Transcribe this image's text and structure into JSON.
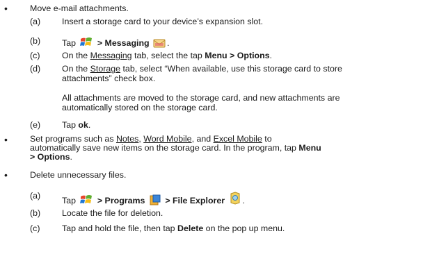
{
  "bullets": [
    {
      "text": "Move e-mail attachments."
    },
    {
      "lines": [
        "Set programs such as ",
        "Notes",
        ", ",
        "Word Mobile",
        ", and ",
        "Excel Mobile",
        " to",
        "automatically save new items on the storage card. In the program, tap ",
        "Menu",
        "> Options",
        "."
      ]
    },
    {
      "text": "Delete unnecessary files."
    }
  ],
  "steps1": {
    "a": {
      "label": "(a)",
      "text": "Insert a storage card to your device’s expansion slot."
    },
    "b": {
      "label": "(b)",
      "pre": "Tap ",
      "bold": "> Messaging",
      "post": "."
    },
    "c": {
      "label": "(c)",
      "pre": "On the ",
      "link": "Messaging",
      "mid": " tab, select the tap ",
      "bold": "Menu > Options",
      "post": "."
    },
    "d": {
      "label": "(d)",
      "pre": "On the ",
      "link": "Storage",
      "line1": " tab, select “When available, use this storage card to store",
      "line2": "attachments” check box."
    },
    "d_para": {
      "line1": "All attachments are moved to the storage card, and new attachments are",
      "line2": "automatically stored on the storage card."
    },
    "e": {
      "label": "(e)",
      "pre": "Tap ",
      "bold": "ok",
      "post": "."
    }
  },
  "steps3": {
    "a": {
      "label": "(a)",
      "pre": "Tap ",
      "bold1": "> Programs",
      "bold2": "> File Explorer",
      "post": "."
    },
    "b": {
      "label": "(b)",
      "text": "Locate the file for deletion."
    },
    "c": {
      "label": "(c)",
      "pre": "Tap and hold the file, then tap ",
      "bold": "Delete",
      "post": " on the pop up menu."
    }
  },
  "icons": {
    "start": "windows-start-icon",
    "messaging": "envelope-icon",
    "programs": "programs-folder-icon",
    "explorer": "file-explorer-icon"
  }
}
